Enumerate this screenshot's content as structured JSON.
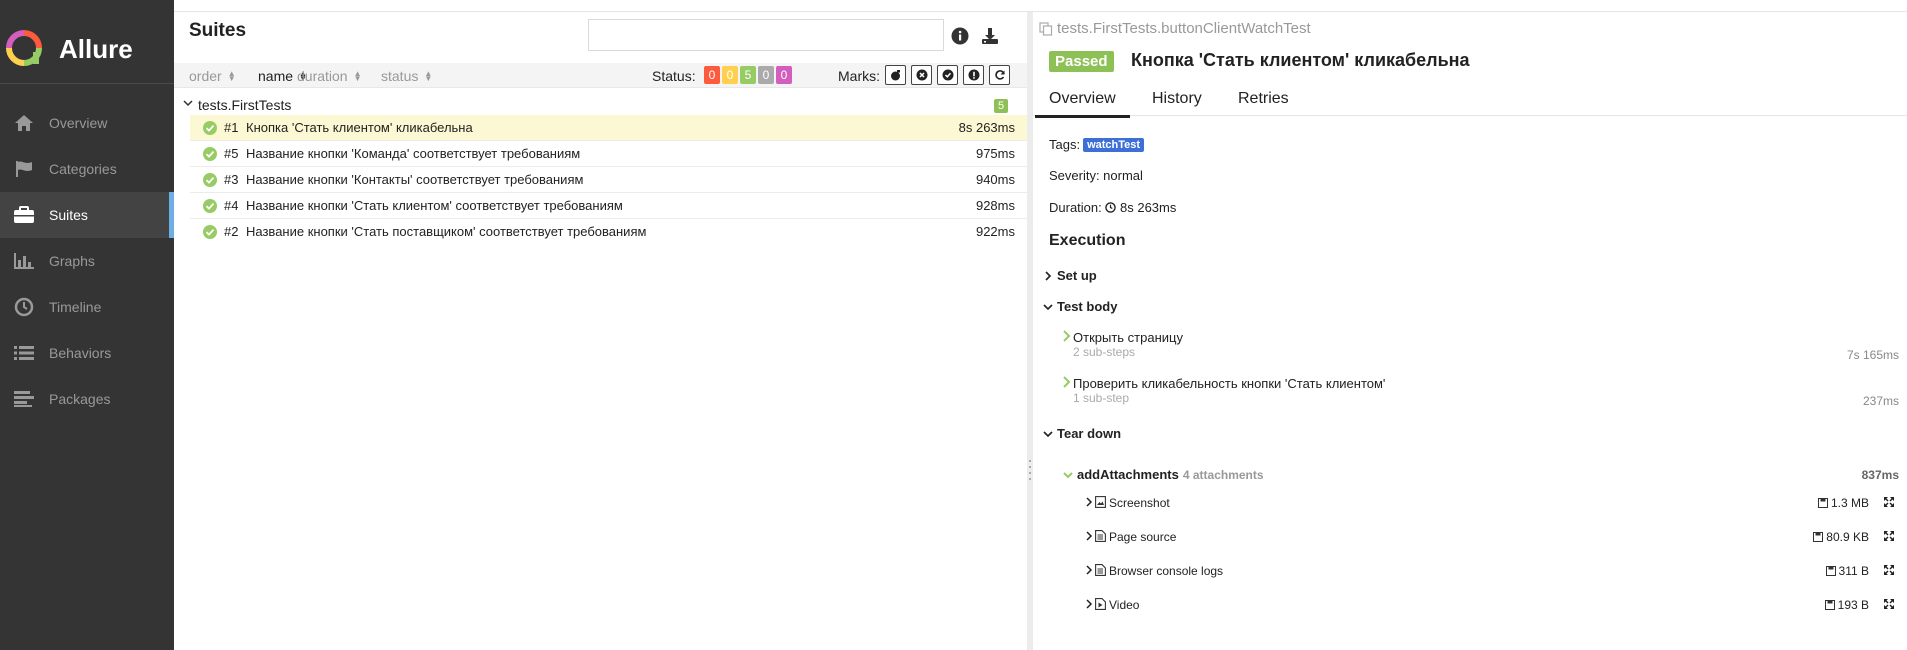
{
  "sidebar": {
    "brand": "Allure",
    "items": [
      {
        "label": "Overview",
        "icon": "home-icon"
      },
      {
        "label": "Categories",
        "icon": "flag-icon"
      },
      {
        "label": "Suites",
        "icon": "briefcase-icon",
        "active": true
      },
      {
        "label": "Graphs",
        "icon": "bar-chart-icon"
      },
      {
        "label": "Timeline",
        "icon": "clock-icon"
      },
      {
        "label": "Behaviors",
        "icon": "list-icon"
      },
      {
        "label": "Packages",
        "icon": "align-left-icon"
      }
    ]
  },
  "suites": {
    "title": "Suites",
    "search_value": "",
    "sort": {
      "order": "order",
      "name": "name",
      "duration": "duration",
      "status": "status"
    },
    "status_label": "Status:",
    "status_counts": [
      {
        "value": "0",
        "color": "#fd5a3e"
      },
      {
        "value": "0",
        "color": "#ffd050"
      },
      {
        "value": "5",
        "color": "#97cc64"
      },
      {
        "value": "0",
        "color": "#aaaaaa"
      },
      {
        "value": "0",
        "color": "#d35ebe"
      }
    ],
    "marks_label": "Marks:",
    "group": {
      "name": "tests.FirstTests",
      "count": "5"
    },
    "rows": [
      {
        "num": "#1",
        "name": "Кнопка 'Стать клиентом' кликабельна",
        "duration": "8s 263ms",
        "selected": true
      },
      {
        "num": "#5",
        "name": "Название кнопки 'Команда' соответствует требованиям",
        "duration": "975ms"
      },
      {
        "num": "#3",
        "name": "Название кнопки 'Контакты' соответствует требованиям",
        "duration": "940ms"
      },
      {
        "num": "#4",
        "name": "Название кнопки 'Стать клиентом' соответствует требованиям",
        "duration": "928ms"
      },
      {
        "num": "#2",
        "name": "Название кнопки 'Стать поставщиком' соответствует требованиям",
        "duration": "922ms"
      }
    ]
  },
  "testcase": {
    "breadcrumb": "tests.FirstTests.buttonClientWatchTest",
    "status": "Passed",
    "status_color": "#97cc64",
    "title": "Кнопка 'Стать клиентом' кликабельна",
    "tabs": [
      "Overview",
      "History",
      "Retries"
    ],
    "tags_label": "Tags:",
    "tag": "watchTest",
    "severity": "Severity: normal",
    "duration_label": "Duration:",
    "duration": "8s 263ms",
    "execution_title": "Execution",
    "setup_label": "Set up",
    "body_label": "Test body",
    "steps": [
      {
        "name": "Открыть страницу",
        "sub": "2 sub-steps",
        "duration": "7s 165ms"
      },
      {
        "name": "Проверить кликабельность кнопки 'Стать клиентом'",
        "sub": "1 sub-step",
        "duration": "237ms"
      }
    ],
    "teardown_label": "Tear down",
    "add_attachments": {
      "name": "addAttachments",
      "count": "4 attachments",
      "duration": "837ms"
    },
    "attachments": [
      {
        "name": "Screenshot",
        "size": "1.3 MB"
      },
      {
        "name": "Page source",
        "size": "80.9 KB"
      },
      {
        "name": "Browser console logs",
        "size": "311 B"
      },
      {
        "name": "Video",
        "size": "193 B"
      }
    ]
  }
}
